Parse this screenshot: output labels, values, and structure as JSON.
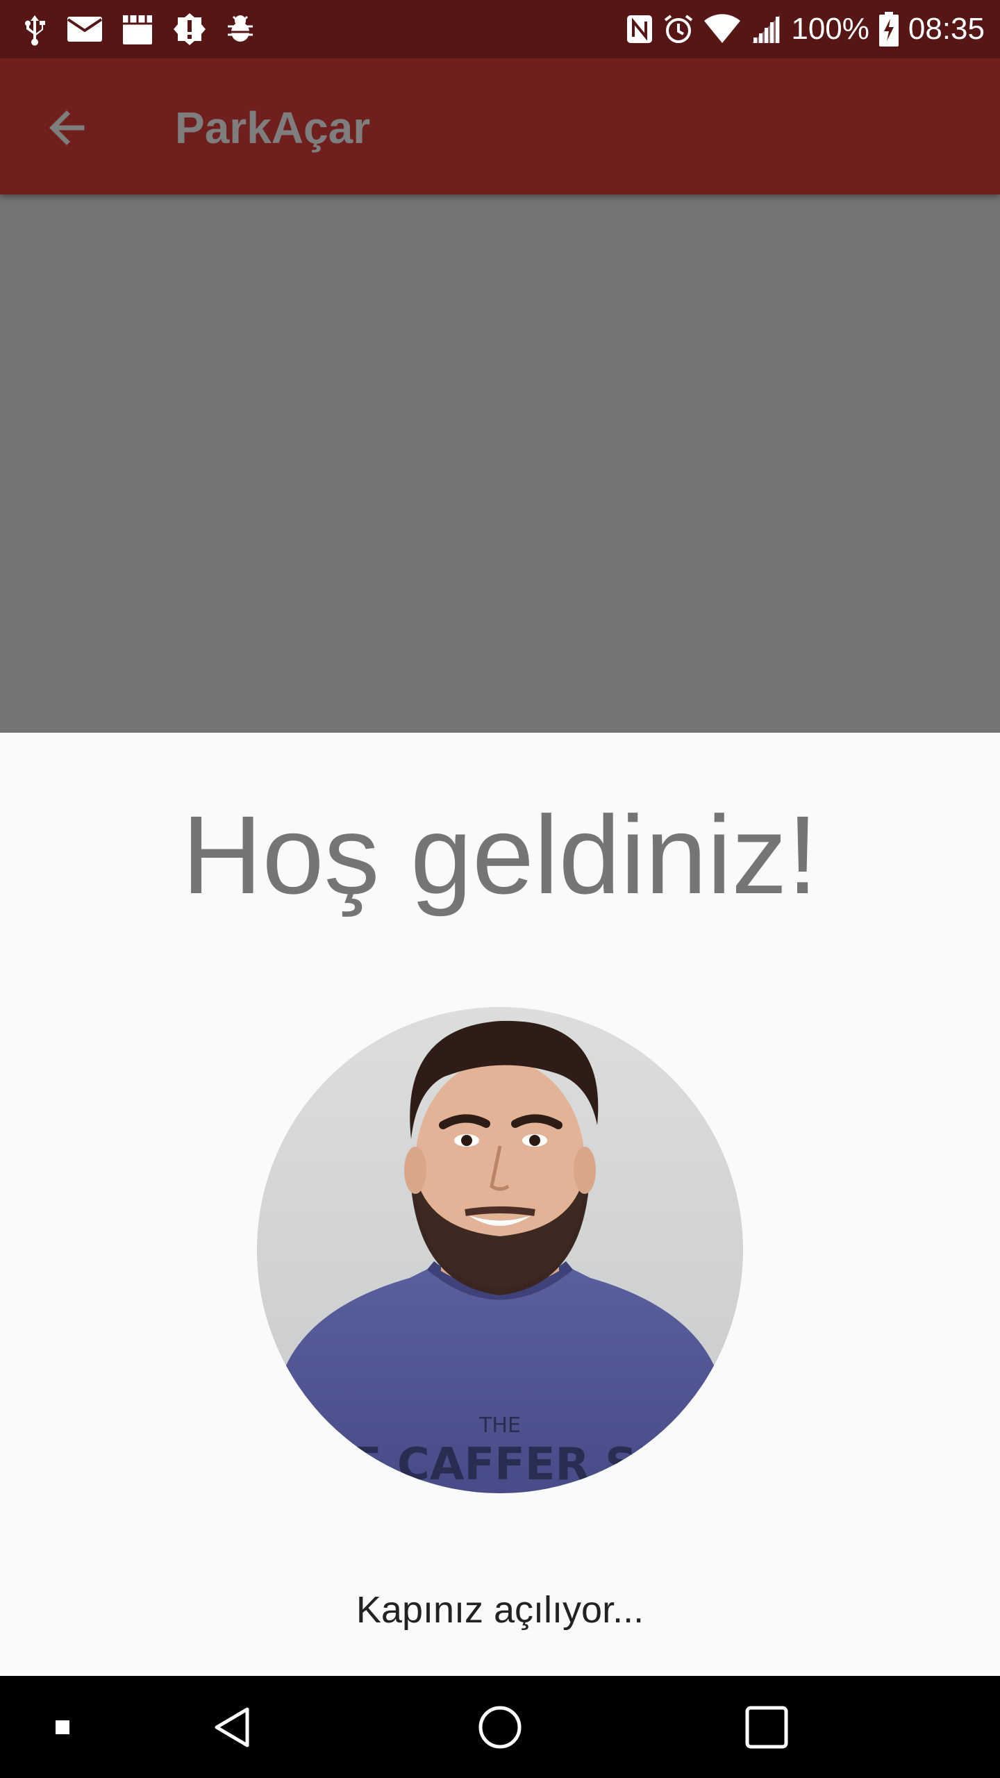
{
  "status_bar": {
    "battery": "100%",
    "time": "08:35",
    "left_icons": [
      "usb-icon",
      "mail-icon",
      "store-icon",
      "alert-icon",
      "bug-icon"
    ],
    "right_icons": [
      "nfc-icon",
      "alarm-icon",
      "wifi-icon",
      "signal-icon",
      "battery-charging-icon"
    ]
  },
  "app_bar": {
    "title": "ParkAçar",
    "back_icon": "arrow-left-icon"
  },
  "content": {
    "welcome": "Hoş geldiniz!",
    "message": "Kapınız açılıyor...",
    "avatar_shirt_text": "THE CAFFER SKLI"
  },
  "nav_bar": {
    "buttons": [
      "small-square-icon",
      "back-triangle-icon",
      "home-circle-icon",
      "recents-square-icon"
    ]
  },
  "colors": {
    "status_bar": "#571616",
    "app_bar": "#6f1f1d",
    "overlay": "#747474",
    "background": "#fafafa",
    "title_text": "#757575"
  }
}
